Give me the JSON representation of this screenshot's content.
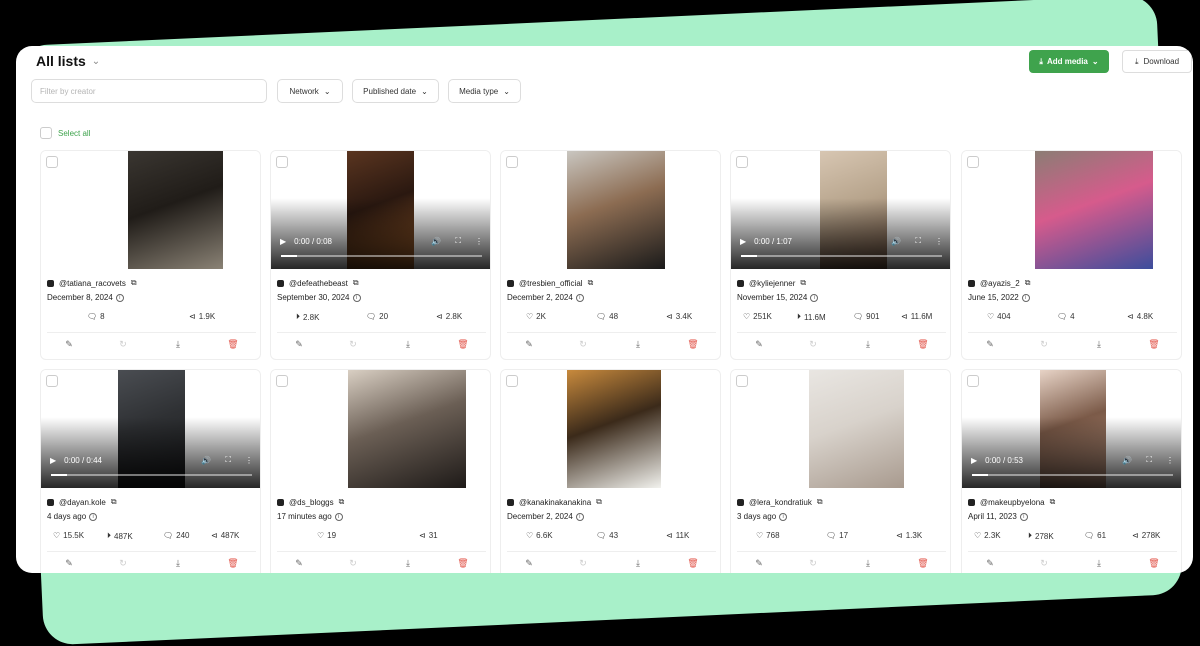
{
  "header": {
    "title": "All lists"
  },
  "toolbar": {
    "add_media_label": "Add media",
    "download_label": "Download"
  },
  "filters": {
    "creator_placeholder": "Filter by creator",
    "network_label": "Network",
    "published_label": "Published date",
    "media_type_label": "Media type"
  },
  "select_all_label": "Select all",
  "cards": [
    {
      "handle": "@tatiana_racovets",
      "date": "December 8, 2024",
      "video": false,
      "img_colors": [
        "#3a3631",
        "#8a8275",
        "#201c18"
      ],
      "stats": [
        {
          "icon": "comment",
          "value": "8"
        },
        {
          "icon": "share",
          "value": "1.9K"
        }
      ]
    },
    {
      "handle": "@defeathebeast",
      "date": "September 30, 2024",
      "video": true,
      "time": "0:00 / 0:08",
      "img_colors": [
        "#5a3520",
        "#b26a2f",
        "#2a1810"
      ],
      "stats": [
        {
          "icon": "play",
          "value": "2.8K"
        },
        {
          "icon": "comment",
          "value": "20"
        },
        {
          "icon": "share",
          "value": "2.8K"
        }
      ]
    },
    {
      "handle": "@tresbien_official",
      "date": "December 2, 2024",
      "video": false,
      "img_colors": [
        "#c9c6c0",
        "#1a1a1a",
        "#8c6c52"
      ],
      "stats": [
        {
          "icon": "heart",
          "value": "2K"
        },
        {
          "icon": "comment",
          "value": "48"
        },
        {
          "icon": "share",
          "value": "3.4K"
        }
      ]
    },
    {
      "handle": "@kyliejenner",
      "date": "November 15, 2024",
      "video": true,
      "time": "0:00 / 1:07",
      "img_colors": [
        "#d7c6b2",
        "#7c5e4a",
        "#b7a48c"
      ],
      "stats": [
        {
          "icon": "heart",
          "value": "251K"
        },
        {
          "icon": "play",
          "value": "11.6M"
        },
        {
          "icon": "comment",
          "value": "901"
        },
        {
          "icon": "share",
          "value": "11.6M"
        }
      ]
    },
    {
      "handle": "@ayazis_2",
      "date": "June 15, 2022",
      "video": false,
      "img_colors": [
        "#8b7d74",
        "#3c4d9c",
        "#d65b8c"
      ],
      "stats": [
        {
          "icon": "heart",
          "value": "404"
        },
        {
          "icon": "comment",
          "value": "4"
        },
        {
          "icon": "share",
          "value": "4.8K"
        }
      ]
    },
    {
      "handle": "@dayan.kole",
      "date": "4 days ago",
      "video": true,
      "time": "0:00 / 0:44",
      "img_colors": [
        "#4a4d52",
        "#1b1c1e",
        "#2e3033"
      ],
      "stats": [
        {
          "icon": "heart",
          "value": "15.5K"
        },
        {
          "icon": "play",
          "value": "487K"
        },
        {
          "icon": "comment",
          "value": "240"
        },
        {
          "icon": "share",
          "value": "487K"
        }
      ]
    },
    {
      "handle": "@ds_bloggs",
      "date": "17 minutes ago",
      "video": false,
      "img_colors": [
        "#d9cfc3",
        "#1e1a18",
        "#6b5f55"
      ],
      "stats": [
        {
          "icon": "heart",
          "value": "19"
        },
        {
          "icon": "share",
          "value": "31"
        }
      ]
    },
    {
      "handle": "@kanakinakanakina",
      "date": "December 2, 2024",
      "video": false,
      "img_colors": [
        "#c88a3d",
        "#f2f2ee",
        "#3b2a1a"
      ],
      "stats": [
        {
          "icon": "heart",
          "value": "6.6K"
        },
        {
          "icon": "comment",
          "value": "43"
        },
        {
          "icon": "share",
          "value": "11K"
        }
      ]
    },
    {
      "handle": "@lera_kondratiuk",
      "date": "3 days ago",
      "video": false,
      "img_colors": [
        "#e9e6e2",
        "#a89a8e",
        "#d8d2cb"
      ],
      "stats": [
        {
          "icon": "heart",
          "value": "768"
        },
        {
          "icon": "comment",
          "value": "17"
        },
        {
          "icon": "share",
          "value": "1.3K"
        }
      ]
    },
    {
      "handle": "@makeupbyelona",
      "date": "April 11, 2023",
      "video": true,
      "time": "0:00 / 0:53",
      "img_colors": [
        "#e7d3c6",
        "#c19a84",
        "#7b5a48"
      ],
      "stats": [
        {
          "icon": "heart",
          "value": "2.3K"
        },
        {
          "icon": "play",
          "value": "278K"
        },
        {
          "icon": "comment",
          "value": "61"
        },
        {
          "icon": "share",
          "value": "278K"
        }
      ]
    }
  ],
  "icons": {
    "heart": "♡",
    "play": "⏵",
    "comment": "🗨",
    "share": "⊲",
    "edit": "✎",
    "refresh": "↻",
    "download": "⤓",
    "delete": "🗑"
  },
  "colors": {
    "accent": "#3fa34d",
    "background_shape": "#a8f0c9",
    "delete": "#e2554a"
  }
}
